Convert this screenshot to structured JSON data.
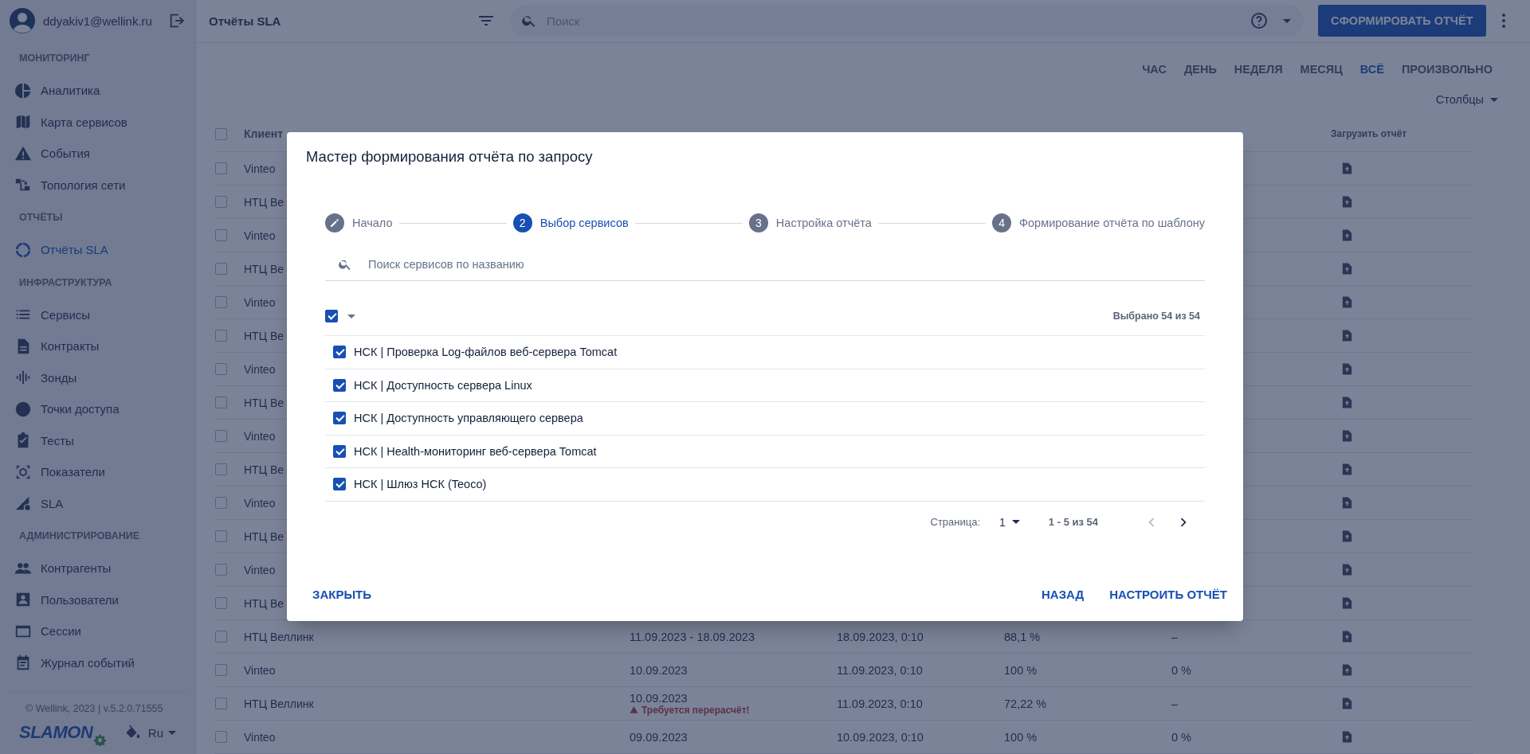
{
  "user": {
    "email": "ddyakiv1@wellink.ru"
  },
  "sidebar": {
    "sections": [
      {
        "title": "МОНИТОРИНГ",
        "items": [
          {
            "label": "Аналитика",
            "selected": false
          },
          {
            "label": "Карта сервисов",
            "selected": false
          },
          {
            "label": "События",
            "selected": false
          },
          {
            "label": "Топология сети",
            "selected": false
          }
        ]
      },
      {
        "title": "ОТЧЁТЫ",
        "items": [
          {
            "label": "Отчёты SLA",
            "selected": true
          }
        ]
      },
      {
        "title": "ИНФРАСТРУКТУРА",
        "items": [
          {
            "label": "Сервисы",
            "selected": false
          },
          {
            "label": "Контракты",
            "selected": false
          },
          {
            "label": "Зонды",
            "selected": false
          },
          {
            "label": "Точки доступа",
            "selected": false
          },
          {
            "label": "Тесты",
            "selected": false
          },
          {
            "label": "Показатели",
            "selected": false
          },
          {
            "label": "SLA",
            "selected": false
          }
        ]
      },
      {
        "title": "АДМИНИСТРИРОВАНИЕ",
        "items": [
          {
            "label": "Контрагенты",
            "selected": false
          },
          {
            "label": "Пользователи",
            "selected": false
          },
          {
            "label": "Сессии",
            "selected": false
          },
          {
            "label": "Журнал событий",
            "selected": false
          }
        ]
      }
    ]
  },
  "footer": {
    "copyright": "© Wellink, 2023 | v.5.2.0.71555",
    "logo": "SLAMON",
    "language": "Ru"
  },
  "topbar": {
    "title": "Отчёты SLA",
    "search": {
      "placeholder": "Поиск"
    },
    "create_button": "СФОРМИРОВАТЬ ОТЧЁТ"
  },
  "periods": [
    {
      "label": "ЧАС",
      "selected": false
    },
    {
      "label": "ДЕНЬ",
      "selected": false
    },
    {
      "label": "НЕДЕЛЯ",
      "selected": false
    },
    {
      "label": "МЕСЯЦ",
      "selected": false
    },
    {
      "label": "ВСЁ",
      "selected": true
    },
    {
      "label": "ПРОИЗВОЛЬНО",
      "selected": false
    }
  ],
  "columns_button": "Столбцы",
  "table": {
    "columns": {
      "client": "Клиент",
      "download": "Загрузить отчёт"
    },
    "header_checked": false,
    "rows": [
      {
        "client": "Vinteo",
        "checked": false
      },
      {
        "client": "НТЦ Ве",
        "checked": false
      },
      {
        "client": "Vinteo",
        "checked": false
      },
      {
        "client": "НТЦ Ве",
        "checked": false
      },
      {
        "client": "Vinteo",
        "checked": false
      },
      {
        "client": "НТЦ Ве",
        "checked": false
      },
      {
        "client": "Vinteo",
        "checked": false
      },
      {
        "client": "НТЦ Ве",
        "checked": false
      },
      {
        "client": "Vinteo",
        "checked": false
      },
      {
        "client": "НТЦ Ве",
        "checked": false
      },
      {
        "client": "Vinteo",
        "checked": false
      },
      {
        "client": "НТЦ Ве",
        "checked": false
      },
      {
        "client": "Vinteo",
        "checked": false
      },
      {
        "client": "НТЦ Ве",
        "checked": false
      },
      {
        "client": "НТЦ Веллинк",
        "checked": false,
        "column_2": "11.09.2023 - 18.09.2023",
        "column_3": "18.09.2023, 0:10",
        "column_4": "88,1 %",
        "column_5": "–"
      },
      {
        "client": "Vinteo",
        "checked": false,
        "column_2": "10.09.2023",
        "column_3": "11.09.2023, 0:10",
        "column_4": "100 %",
        "column_5": "0 %"
      },
      {
        "client": "НТЦ Веллинк",
        "checked": false,
        "column_2": "10.09.2023",
        "warning": "Требуется перерасчёт!",
        "column_3": "11.09.2023, 0:10",
        "column_4": "72,22 %",
        "column_5": "–"
      },
      {
        "client": "Vinteo",
        "checked": false,
        "column_2": "09.09.2023",
        "column_3": "10.09.2023, 0:10",
        "column_4": "100 %",
        "column_5": "0 %"
      }
    ]
  },
  "dialog": {
    "title": "Мастер формирования отчёта по запросу",
    "steps": [
      {
        "label": "Начало",
        "completed": true,
        "selected": false
      },
      {
        "number": "2",
        "label": "Выбор сервисов",
        "completed": false,
        "selected": true
      },
      {
        "number": "3",
        "label": "Настройка отчёта",
        "completed": false,
        "selected": false
      },
      {
        "number": "4",
        "label": "Формирование отчёта по шаблону",
        "completed": false,
        "selected": false
      }
    ],
    "search": {
      "placeholder": "Поиск сервисов по названию"
    },
    "select_all": {
      "checked": true
    },
    "selected_count": "Выбрано 54 из 54",
    "services": [
      {
        "label": "НСК | Проверка Log-файлов веб-сервера Tomcat",
        "checked": true
      },
      {
        "label": "НСК | Доступность сервера Linux",
        "checked": true
      },
      {
        "label": "НСК | Доступность управляющего сервера",
        "checked": true
      },
      {
        "label": "НСК | Health-мониторинг веб-сервера Tomcat",
        "checked": true
      },
      {
        "label": "НСК | Шлюз НСК (Teoco)",
        "checked": true
      }
    ],
    "pagination": {
      "label": "Страница:",
      "page": "1",
      "range": "1 - 5 из 54",
      "prev_disabled": true,
      "next_disabled": false
    },
    "buttons": {
      "close": "ЗАКРЫТЬ",
      "back": "НАЗАД",
      "next": "НАСТРОИТЬ ОТЧЁТ"
    }
  }
}
